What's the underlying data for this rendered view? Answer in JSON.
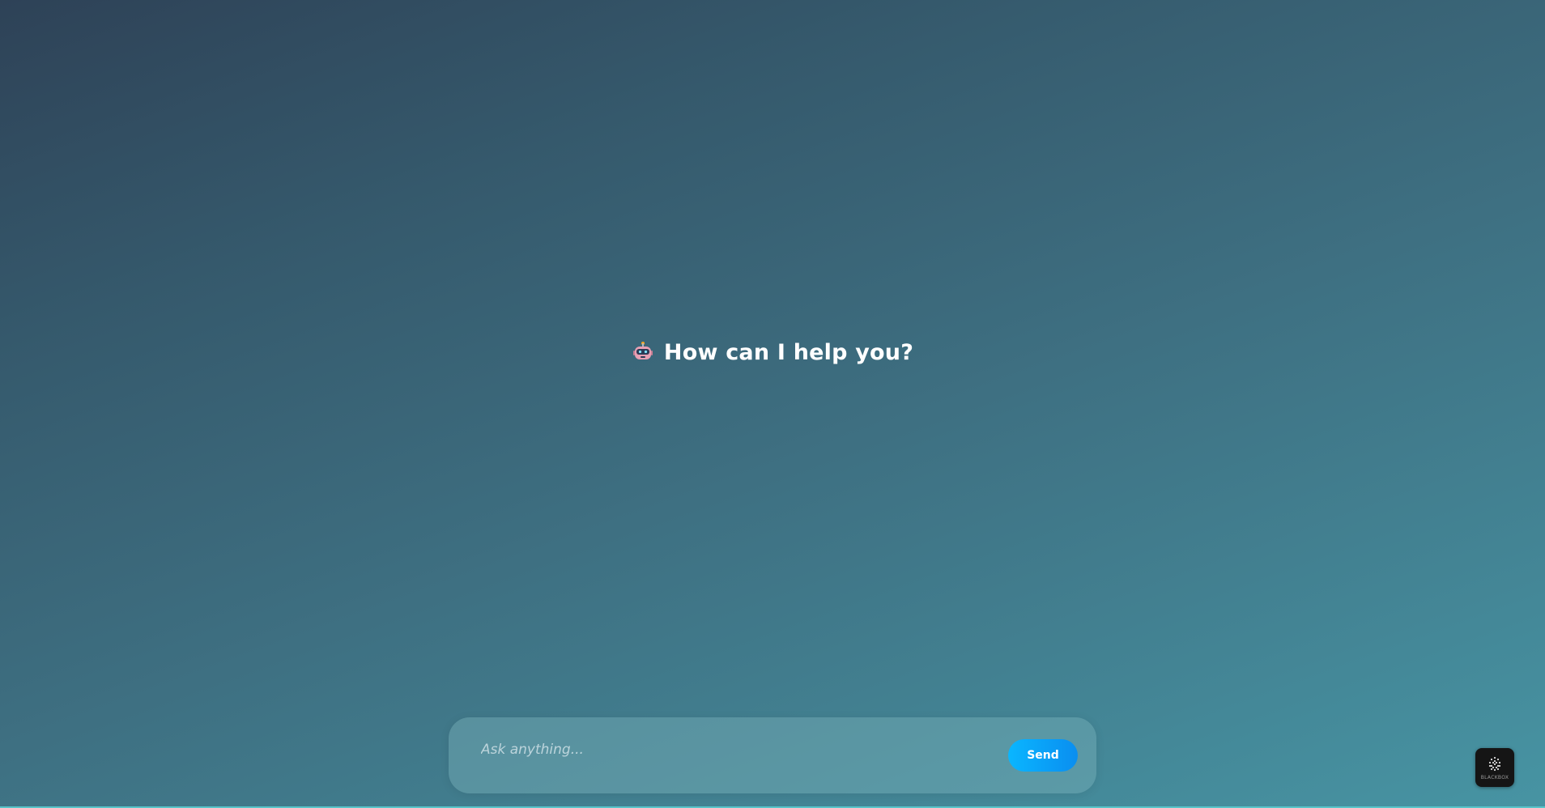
{
  "hero": {
    "icon": "robot-icon",
    "title": "How can I help you?"
  },
  "composer": {
    "placeholder": "Ask anything...",
    "value": "",
    "send_label": "Send"
  },
  "badge": {
    "icon": "blackbox-logo-icon",
    "text": "BLACKBOX"
  },
  "colors": {
    "background_start": "#2e4257",
    "background_end": "#4794a3",
    "send_button": "#0ab6ff",
    "title_text": "#ffffff"
  }
}
